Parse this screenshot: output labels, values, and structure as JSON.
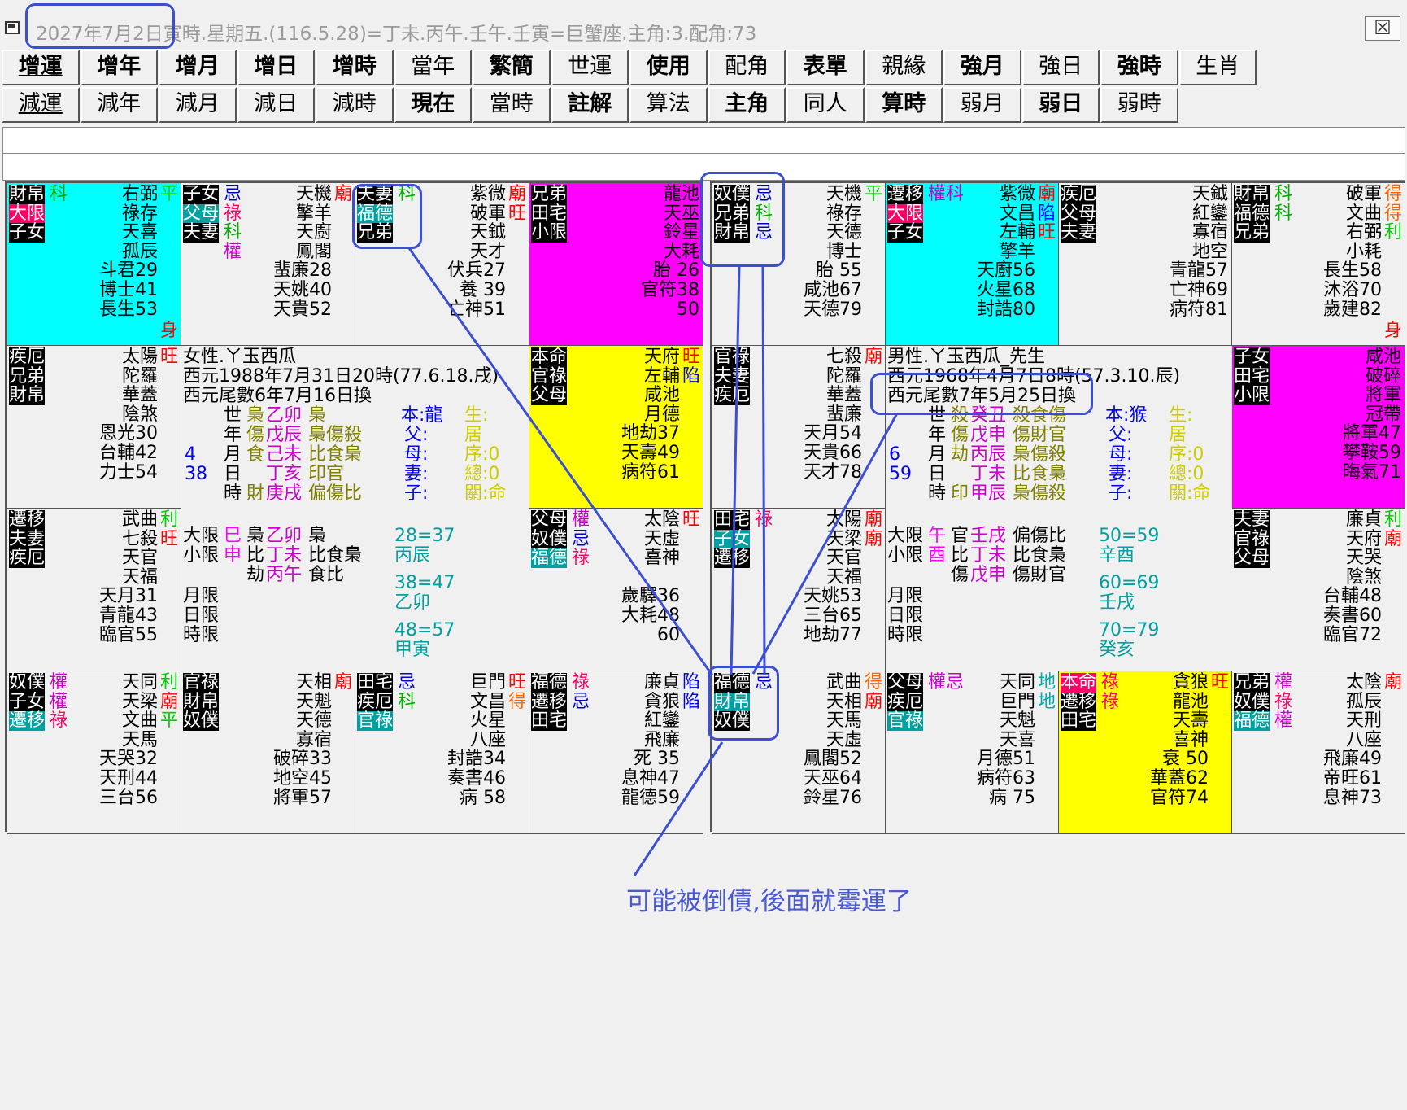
{
  "window_title": "2027年7月2日寅時.星期五.(116.5.28)=丁未.丙午.壬午.壬寅=巨蟹座.主角:3.配角:73",
  "close_label": "☒",
  "toolbar_row1": [
    "增運",
    "增年",
    "增月",
    "增日",
    "增時",
    "當年",
    "繁簡",
    "世運",
    "使用",
    "配角",
    "表單",
    "親緣",
    "強月",
    "強日",
    "強時",
    "生肖"
  ],
  "toolbar_row2": [
    "減運",
    "減年",
    "減月",
    "減日",
    "減時",
    "現在",
    "當時",
    "註解",
    "算法",
    "主角",
    "同人",
    "算時",
    "弱月",
    "弱日",
    "弱時"
  ],
  "annotation_note": "可能被倒債,後面就霉運了",
  "colors": {
    "cyan": "#00ffff",
    "magenta": "#ff00ff",
    "yellow": "#ffff00",
    "annotation": "#3b4fd0"
  },
  "left_chart": {
    "center": {
      "line1": "女性.ㄚ玉西瓜",
      "line2": "西元1988年7月31日20時(77.6.18.戌)",
      "line3": "西元尾數6年7月16日換",
      "pillars": [
        {
          "label": "世",
          "a": "梟",
          "b": "乙卯",
          "c": "梟"
        },
        {
          "label": "年",
          "a": "傷",
          "b": "戊辰",
          "c": "梟傷殺"
        },
        {
          "label": "月",
          "a": "食",
          "b": "己未",
          "c": "比食梟"
        },
        {
          "label": "日",
          "a": "",
          "b": "丁亥",
          "c": "印官"
        },
        {
          "label": "時",
          "a": "財",
          "b": "庚戌",
          "c": "偏傷比"
        }
      ],
      "num1": "4",
      "num2": "38",
      "ming": "本:龍",
      "father": "父:",
      "mother": "母:",
      "spouse": "妻:",
      "child": "子:",
      "sheng": "生:",
      "ju": "居",
      "xu": "序:0",
      "zong": "總:0",
      "guan": "關:命",
      "daxian": "大限",
      "xiaoxian": "小限",
      "dx1": "巳",
      "dx2": "申",
      "r1": "梟",
      "r1b": "乙卯",
      "r1c": "梟",
      "r2": "比",
      "r2b": "丁未",
      "r2c": "比食梟",
      "r3": "劫",
      "r3b": "丙午",
      "r3c": "食比",
      "yuexian": "月限",
      "rixian": "日限",
      "shixian": "時限",
      "ages": [
        "28=37",
        "丙辰",
        "38=47",
        "乙卯",
        "48=57",
        "甲寅"
      ]
    },
    "cells": [
      {
        "palaces": [
          "財帛",
          "大限",
          "子女"
        ],
        "sihua": [
          "科"
        ],
        "stars": [
          "右弼",
          "祿存",
          "天喜",
          "孤辰",
          "斗君29",
          "博士41",
          "長生53"
        ],
        "status": "平",
        "shen": "身"
      },
      {
        "palaces": [
          "子女",
          "父母",
          "夫妻"
        ],
        "sihua": [
          "忌",
          "祿",
          "科",
          "權"
        ],
        "stars": [
          "天機",
          "擎羊",
          "天廚",
          "鳳閣",
          "蜚廉28",
          "天姚40",
          "天貴52"
        ],
        "status": "廟"
      },
      {
        "palaces": [
          "夫妻",
          "福德",
          "兄弟"
        ],
        "sihua": [
          "科"
        ],
        "stars": [
          "紫微",
          "破軍",
          "天鉞",
          "天才",
          "伏兵27",
          "養 39",
          "亡神51"
        ],
        "status": "廟",
        "status2": "旺"
      },
      {
        "palaces": [
          "兄弟",
          "田宅",
          "小限"
        ],
        "sihua": [],
        "stars": [
          "龍池",
          "天巫",
          "鈴星",
          "大耗",
          "胎 26",
          "官符38",
          "50"
        ]
      },
      {
        "palaces": [
          "疾厄",
          "兄弟",
          "財帛"
        ],
        "sihua": [],
        "stars": [
          "太陽",
          "陀羅",
          "華蓋",
          "陰煞",
          "恩光30",
          "台輔42",
          "力士54"
        ],
        "status": "旺"
      },
      {
        "palaces": [
          "本命",
          "官祿",
          "父母"
        ],
        "sihua": [],
        "stars": [
          "天府",
          "左輔",
          "咸池",
          "月德",
          "地劫37",
          "天壽49",
          "病符61"
        ],
        "status": "旺",
        "status2": "陷"
      },
      {
        "palaces": [
          "遷移",
          "夫妻",
          "疾厄"
        ],
        "sihua": [],
        "stars": [
          "武曲",
          "七殺",
          "天官",
          "天福",
          "天月31",
          "青龍43",
          "臨官55"
        ],
        "status": "利",
        "status2": "旺"
      },
      {
        "palaces": [
          "父母",
          "奴僕",
          "福德"
        ],
        "sihua": [
          "權",
          "忌",
          "祿"
        ],
        "stars": [
          "太陰",
          "天虛",
          "喜神",
          "",
          "歲驛36",
          "大耗48",
          "60"
        ],
        "status": "旺"
      },
      {
        "palaces": [
          "奴僕",
          "子女",
          "遷移"
        ],
        "sihua": [
          "權",
          "權",
          "祿"
        ],
        "stars": [
          "天同",
          "天梁",
          "文曲",
          "天馬",
          "天哭32",
          "天刑44",
          "三台56"
        ],
        "status": "利",
        "status2": "廟",
        "status3": "平"
      },
      {
        "palaces": [
          "官祿",
          "財帛",
          "奴僕"
        ],
        "sihua": [],
        "stars": [
          "天相",
          "天魁",
          "天德",
          "寡宿",
          "破碎33",
          "地空45",
          "將軍57"
        ],
        "status": "廟"
      },
      {
        "palaces": [
          "田宅",
          "疾厄",
          "官祿"
        ],
        "sihua": [
          "忌",
          "科"
        ],
        "stars": [
          "巨門",
          "文昌",
          "火星",
          "八座",
          "封誥34",
          "奏書46",
          "病 58"
        ],
        "status": "旺",
        "status2": "得"
      },
      {
        "palaces": [
          "福德",
          "遷移",
          "田宅"
        ],
        "sihua": [
          "祿",
          "忌"
        ],
        "stars": [
          "廉貞",
          "貪狼",
          "紅鑾",
          "飛廉",
          "死 35",
          "息神47",
          "龍德59"
        ],
        "status": "陷",
        "status2": "陷"
      }
    ]
  },
  "right_chart": {
    "center": {
      "line1": "男性.ㄚ玉西瓜_先生",
      "line2": "西元1968年4月7日8時(57.3.10.辰)",
      "line3": "西元尾數7年5月25日換",
      "pillars": [
        {
          "label": "世",
          "a": "殺",
          "b": "癸丑",
          "c": "殺食傷"
        },
        {
          "label": "年",
          "a": "傷",
          "b": "戊申",
          "c": "傷財官"
        },
        {
          "label": "月",
          "a": "劫",
          "b": "丙辰",
          "c": "梟傷殺"
        },
        {
          "label": "日",
          "a": "",
          "b": "丁未",
          "c": "比食梟"
        },
        {
          "label": "時",
          "a": "印",
          "b": "甲辰",
          "c": "梟傷殺"
        }
      ],
      "num1": "6",
      "num2": "59",
      "ming": "本:猴",
      "father": "父:",
      "mother": "母:",
      "spouse": "妻:",
      "child": "子:",
      "sheng": "生:",
      "ju": "居",
      "xu": "序:0",
      "zong": "總:0",
      "guan": "關:命",
      "daxian": "大限",
      "xiaoxian": "小限",
      "dx1": "午",
      "dx2": "酉",
      "r1": "官",
      "r1b": "壬戌",
      "r1c": "偏傷比",
      "r2": "比",
      "r2b": "丁未",
      "r2c": "比食梟",
      "r3": "傷",
      "r3b": "戊申",
      "r3c": "傷財官",
      "yuexian": "月限",
      "rixian": "日限",
      "shixian": "時限",
      "ages": [
        "50=59",
        "辛酉",
        "60=69",
        "壬戌",
        "70=79",
        "癸亥"
      ]
    },
    "cells": [
      {
        "palaces": [
          "奴僕",
          "兄弟",
          "財帛"
        ],
        "sihua": [
          "忌",
          "科",
          "忌"
        ],
        "stars": [
          "天機",
          "祿存",
          "天德",
          "博士",
          "胎 55",
          "咸池67",
          "天德79"
        ],
        "status": "平"
      },
      {
        "palaces": [
          "遷移",
          "大限",
          "子女"
        ],
        "sihua": [
          "權科"
        ],
        "stars": [
          "紫微",
          "文昌",
          "左輔",
          "擎羊",
          "天廚56",
          "火星68",
          "封誥80"
        ],
        "status": "廟",
        "status2": "陷",
        "status3": "旺"
      },
      {
        "palaces": [
          "疾厄",
          "父母",
          "夫妻"
        ],
        "sihua": [],
        "stars": [
          "天鉞",
          "紅鑾",
          "寡宿",
          "地空",
          "青龍57",
          "亡神69",
          "病符81"
        ]
      },
      {
        "palaces": [
          "財帛",
          "福德",
          "兄弟"
        ],
        "sihua": [
          "科",
          "科"
        ],
        "stars": [
          "破軍",
          "文曲",
          "右弼",
          "小耗",
          "長生58",
          "沐浴70",
          "歲建82"
        ],
        "status": "得",
        "status2": "得",
        "status3": "利",
        "shen": "身"
      },
      {
        "palaces": [
          "官祿",
          "夫妻",
          "疾厄"
        ],
        "sihua": [],
        "stars": [
          "七殺",
          "陀羅",
          "華蓋",
          "蜚廉",
          "天月54",
          "天貴66",
          "天才78"
        ],
        "status": "廟"
      },
      {
        "palaces": [
          "子女",
          "田宅",
          "小限"
        ],
        "sihua": [],
        "stars": [
          "咸池",
          "破碎",
          "將軍",
          "冠帶",
          "將軍47",
          "攀鞍59",
          "晦氣71"
        ]
      },
      {
        "palaces": [
          "田宅",
          "子女",
          "遷移"
        ],
        "sihua": [
          "祿"
        ],
        "stars": [
          "太陽",
          "天梁",
          "天官",
          "天福",
          "天姚53",
          "三台65",
          "地劫77"
        ],
        "status": "廟",
        "status2": "廟"
      },
      {
        "palaces": [
          "夫妻",
          "官祿",
          "父母"
        ],
        "sihua": [],
        "stars": [
          "廉貞",
          "天府",
          "天哭",
          "陰煞",
          "台輔48",
          "奏書60",
          "臨官72"
        ],
        "status": "利",
        "status2": "廟"
      },
      {
        "palaces": [
          "福德",
          "財帛",
          "奴僕"
        ],
        "sihua": [
          "忌"
        ],
        "stars": [
          "武曲",
          "天相",
          "天馬",
          "天虛",
          "鳳閣52",
          "天巫64",
          "鈴星76"
        ],
        "status": "得",
        "status2": "廟"
      },
      {
        "palaces": [
          "父母",
          "疾厄",
          "官祿"
        ],
        "sihua": [
          "權忌"
        ],
        "stars": [
          "天同",
          "巨門",
          "天魁",
          "天喜",
          "月德51",
          "病符63",
          "病 75"
        ],
        "status": "地",
        "status2": "地"
      },
      {
        "palaces": [
          "本命",
          "遷移",
          "田宅"
        ],
        "sihua": [
          "祿",
          "祿"
        ],
        "stars": [
          "貪狼",
          "龍池",
          "天壽",
          "喜神",
          "衰 50",
          "華蓋62",
          "官符74"
        ],
        "status": "旺"
      },
      {
        "palaces": [
          "兄弟",
          "奴僕",
          "福德"
        ],
        "sihua": [
          "權",
          "祿",
          "權"
        ],
        "stars": [
          "太陰",
          "孤辰",
          "天刑",
          "八座",
          "飛廉49",
          "帝旺61",
          "息神73"
        ],
        "status": "廟"
      }
    ]
  }
}
